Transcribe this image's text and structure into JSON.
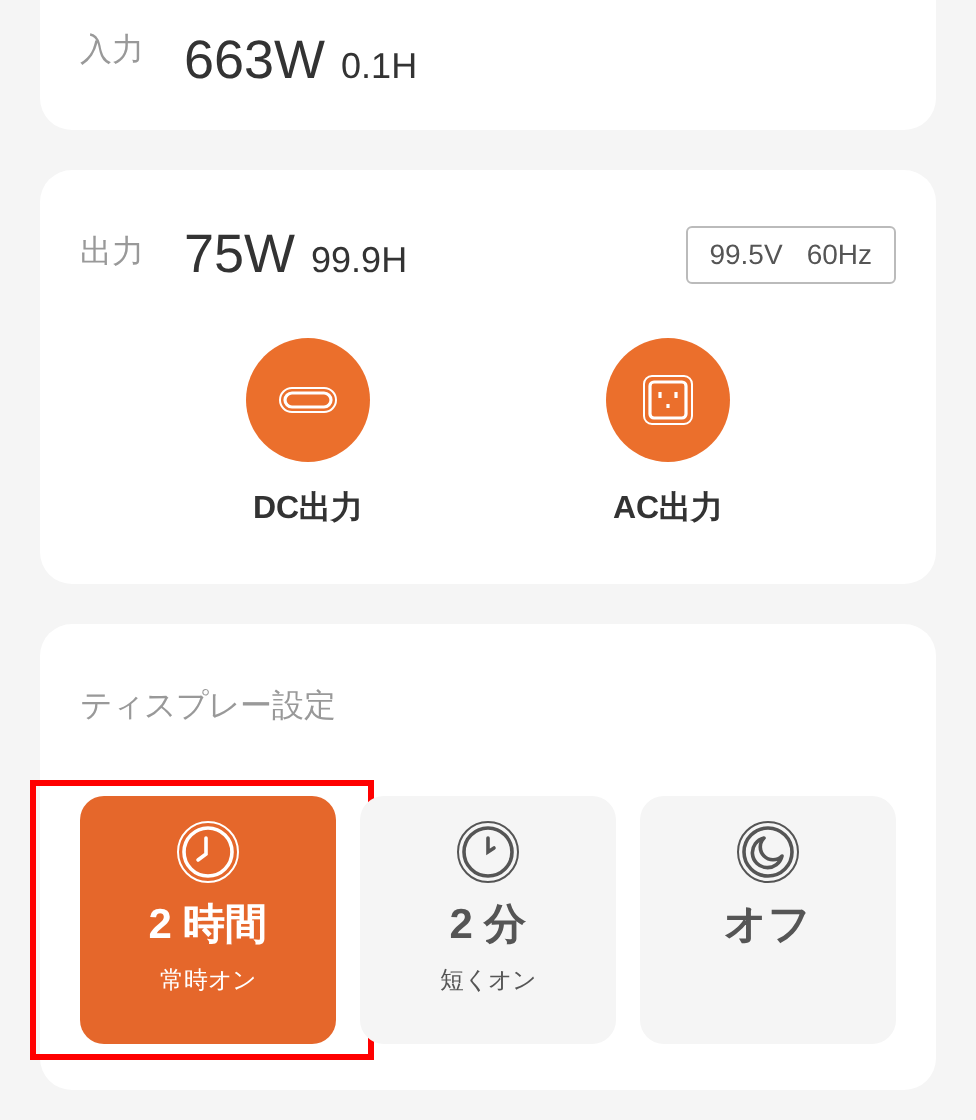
{
  "input": {
    "label": "入力",
    "power": "663W",
    "duration": "0.1H"
  },
  "output": {
    "label": "出力",
    "power": "75W",
    "duration": "99.9H",
    "voltage": "99.5V",
    "frequency": "60Hz",
    "ports": [
      {
        "kind": "dc",
        "label": "DC出力"
      },
      {
        "kind": "ac",
        "label": "AC出力"
      }
    ]
  },
  "display": {
    "title": "ティスプレー設定",
    "options": [
      {
        "kind": "clock",
        "title": "2 時間",
        "subtitle": "常時オン",
        "selected": true,
        "highlighted": true
      },
      {
        "kind": "clock-short",
        "title": "2 分",
        "subtitle": "短くオン",
        "selected": false,
        "highlighted": false
      },
      {
        "kind": "moon",
        "title": "オフ",
        "selected": false,
        "highlighted": false
      }
    ]
  }
}
